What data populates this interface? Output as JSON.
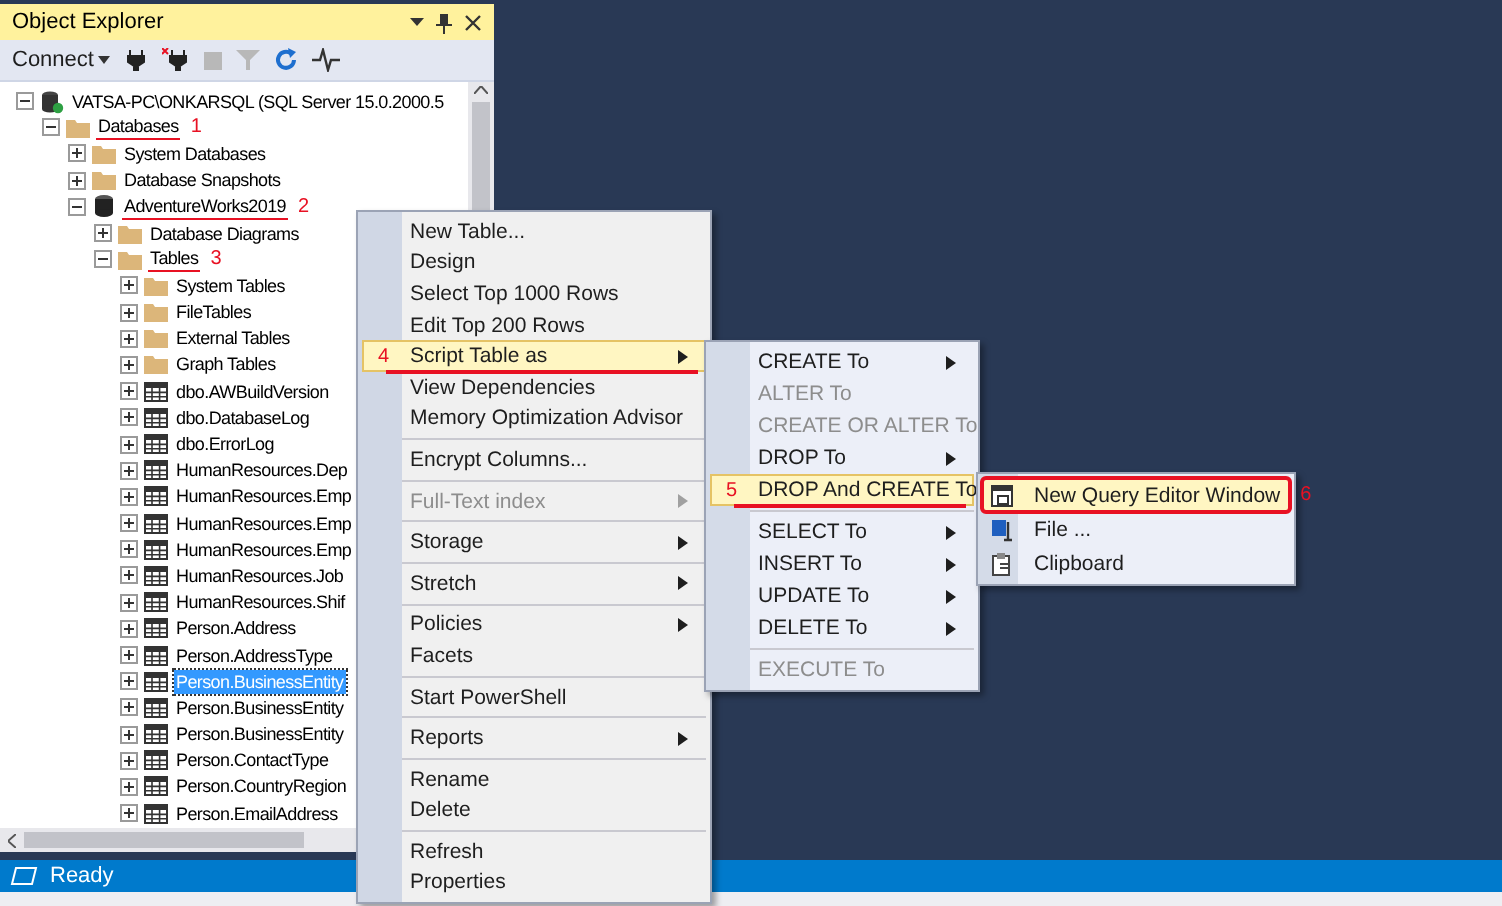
{
  "panel": {
    "title": "Object Explorer",
    "toolbar": {
      "connect": "Connect"
    }
  },
  "tree": [
    {
      "label": "VATSA-PC\\ONKARSQL (SQL Server 15.0.2000.5",
      "kind": "server",
      "expanded": true,
      "selected": false,
      "children": [
        {
          "label": "Databases",
          "kind": "folder",
          "expanded": true,
          "selected": false,
          "marker": "1",
          "children": [
            {
              "label": "System Databases",
              "kind": "folder",
              "expanded": false,
              "selected": false
            },
            {
              "label": "Database Snapshots",
              "kind": "folder",
              "expanded": false,
              "selected": false
            },
            {
              "label": "AdventureWorks2019",
              "kind": "database",
              "expanded": true,
              "selected": false,
              "marker": "2",
              "children": [
                {
                  "label": "Database Diagrams",
                  "kind": "folder",
                  "expanded": false,
                  "selected": false
                },
                {
                  "label": "Tables",
                  "kind": "folder",
                  "expanded": true,
                  "selected": false,
                  "marker": "3",
                  "children": [
                    {
                      "label": "System Tables",
                      "kind": "folder",
                      "expanded": false,
                      "selected": false
                    },
                    {
                      "label": "FileTables",
                      "kind": "folder",
                      "expanded": false,
                      "selected": false
                    },
                    {
                      "label": "External Tables",
                      "kind": "folder",
                      "expanded": false,
                      "selected": false
                    },
                    {
                      "label": "Graph Tables",
                      "kind": "folder",
                      "expanded": false,
                      "selected": false
                    },
                    {
                      "label": "dbo.AWBuildVersion",
                      "kind": "table",
                      "expanded": false,
                      "selected": false
                    },
                    {
                      "label": "dbo.DatabaseLog",
                      "kind": "table",
                      "expanded": false,
                      "selected": false
                    },
                    {
                      "label": "dbo.ErrorLog",
                      "kind": "table",
                      "expanded": false,
                      "selected": false
                    },
                    {
                      "label": "HumanResources.Dep",
                      "kind": "table",
                      "expanded": false,
                      "selected": false
                    },
                    {
                      "label": "HumanResources.Emp",
                      "kind": "table",
                      "expanded": false,
                      "selected": false
                    },
                    {
                      "label": "HumanResources.Emp",
                      "kind": "table",
                      "expanded": false,
                      "selected": false
                    },
                    {
                      "label": "HumanResources.Emp",
                      "kind": "table",
                      "expanded": false,
                      "selected": false
                    },
                    {
                      "label": "HumanResources.Job",
                      "kind": "table",
                      "expanded": false,
                      "selected": false
                    },
                    {
                      "label": "HumanResources.Shif",
                      "kind": "table",
                      "expanded": false,
                      "selected": false
                    },
                    {
                      "label": "Person.Address",
                      "kind": "table",
                      "expanded": false,
                      "selected": false
                    },
                    {
                      "label": "Person.AddressType",
                      "kind": "table",
                      "expanded": false,
                      "selected": false
                    },
                    {
                      "label": "Person.BusinessEntity",
                      "kind": "table",
                      "expanded": false,
                      "selected": true
                    },
                    {
                      "label": "Person.BusinessEntity",
                      "kind": "table",
                      "expanded": false,
                      "selected": false
                    },
                    {
                      "label": "Person.BusinessEntity",
                      "kind": "table",
                      "expanded": false,
                      "selected": false
                    },
                    {
                      "label": "Person.ContactType",
                      "kind": "table",
                      "expanded": false,
                      "selected": false
                    },
                    {
                      "label": "Person.CountryRegion",
                      "kind": "table",
                      "expanded": false,
                      "selected": false
                    },
                    {
                      "label": "Person.EmailAddress",
                      "kind": "table",
                      "expanded": false,
                      "selected": false
                    }
                  ]
                }
              ]
            }
          ]
        }
      ]
    }
  ],
  "context_menu": [
    {
      "kind": "item",
      "label": "New Table...",
      "disabled": false,
      "submenu": false,
      "selected": false
    },
    {
      "kind": "item",
      "label": "Design",
      "disabled": false,
      "submenu": false,
      "selected": false
    },
    {
      "kind": "item",
      "label": "Select Top 1000 Rows",
      "disabled": false,
      "submenu": false,
      "selected": false
    },
    {
      "kind": "item",
      "label": "Edit Top 200 Rows",
      "disabled": false,
      "submenu": false,
      "selected": false
    },
    {
      "kind": "item",
      "label": "Script Table as",
      "disabled": false,
      "submenu": true,
      "selected": true,
      "marker": "4"
    },
    {
      "kind": "item",
      "label": "View Dependencies",
      "disabled": false,
      "submenu": false,
      "selected": false
    },
    {
      "kind": "item",
      "label": "Memory Optimization Advisor",
      "disabled": false,
      "submenu": false,
      "selected": false
    },
    {
      "kind": "separator"
    },
    {
      "kind": "item",
      "label": "Encrypt Columns...",
      "disabled": false,
      "submenu": false,
      "selected": false
    },
    {
      "kind": "separator"
    },
    {
      "kind": "item",
      "label": "Full-Text index",
      "disabled": true,
      "submenu": true,
      "selected": false
    },
    {
      "kind": "separator"
    },
    {
      "kind": "item",
      "label": "Storage",
      "disabled": false,
      "submenu": true,
      "selected": false
    },
    {
      "kind": "separator"
    },
    {
      "kind": "item",
      "label": "Stretch",
      "disabled": false,
      "submenu": true,
      "selected": false
    },
    {
      "kind": "separator"
    },
    {
      "kind": "item",
      "label": "Policies",
      "disabled": false,
      "submenu": true,
      "selected": false
    },
    {
      "kind": "item",
      "label": "Facets",
      "disabled": false,
      "submenu": false,
      "selected": false
    },
    {
      "kind": "separator"
    },
    {
      "kind": "item",
      "label": "Start PowerShell",
      "disabled": false,
      "submenu": false,
      "selected": false
    },
    {
      "kind": "separator"
    },
    {
      "kind": "item",
      "label": "Reports",
      "disabled": false,
      "submenu": true,
      "selected": false
    },
    {
      "kind": "separator"
    },
    {
      "kind": "item",
      "label": "Rename",
      "disabled": false,
      "submenu": false,
      "selected": false
    },
    {
      "kind": "item",
      "label": "Delete",
      "disabled": false,
      "submenu": false,
      "selected": false
    },
    {
      "kind": "separator"
    },
    {
      "kind": "item",
      "label": "Refresh",
      "disabled": false,
      "submenu": false,
      "selected": false
    },
    {
      "kind": "item",
      "label": "Properties",
      "disabled": false,
      "submenu": false,
      "selected": false
    }
  ],
  "script_submenu": [
    {
      "kind": "item",
      "label": "CREATE To",
      "disabled": false,
      "submenu": true,
      "selected": false
    },
    {
      "kind": "item",
      "label": "ALTER To",
      "disabled": true,
      "submenu": false,
      "selected": false
    },
    {
      "kind": "item",
      "label": "CREATE OR ALTER To",
      "disabled": true,
      "submenu": false,
      "selected": false
    },
    {
      "kind": "item",
      "label": "DROP To",
      "disabled": false,
      "submenu": true,
      "selected": false
    },
    {
      "kind": "item",
      "label": "DROP And CREATE To",
      "disabled": false,
      "submenu": true,
      "selected": true,
      "marker": "5"
    },
    {
      "kind": "separator"
    },
    {
      "kind": "item",
      "label": "SELECT To",
      "disabled": false,
      "submenu": true,
      "selected": false
    },
    {
      "kind": "item",
      "label": "INSERT To",
      "disabled": false,
      "submenu": true,
      "selected": false
    },
    {
      "kind": "item",
      "label": "UPDATE To",
      "disabled": false,
      "submenu": true,
      "selected": false
    },
    {
      "kind": "item",
      "label": "DELETE To",
      "disabled": false,
      "submenu": true,
      "selected": false
    },
    {
      "kind": "separator"
    },
    {
      "kind": "item",
      "label": "EXECUTE To",
      "disabled": true,
      "submenu": false,
      "selected": false
    }
  ],
  "target_submenu": [
    {
      "label": "New Query Editor Window",
      "selected": true,
      "marker": "6"
    },
    {
      "label": "File ...",
      "selected": false
    },
    {
      "label": "Clipboard",
      "selected": false
    }
  ],
  "status_bar": {
    "text": "Ready"
  }
}
